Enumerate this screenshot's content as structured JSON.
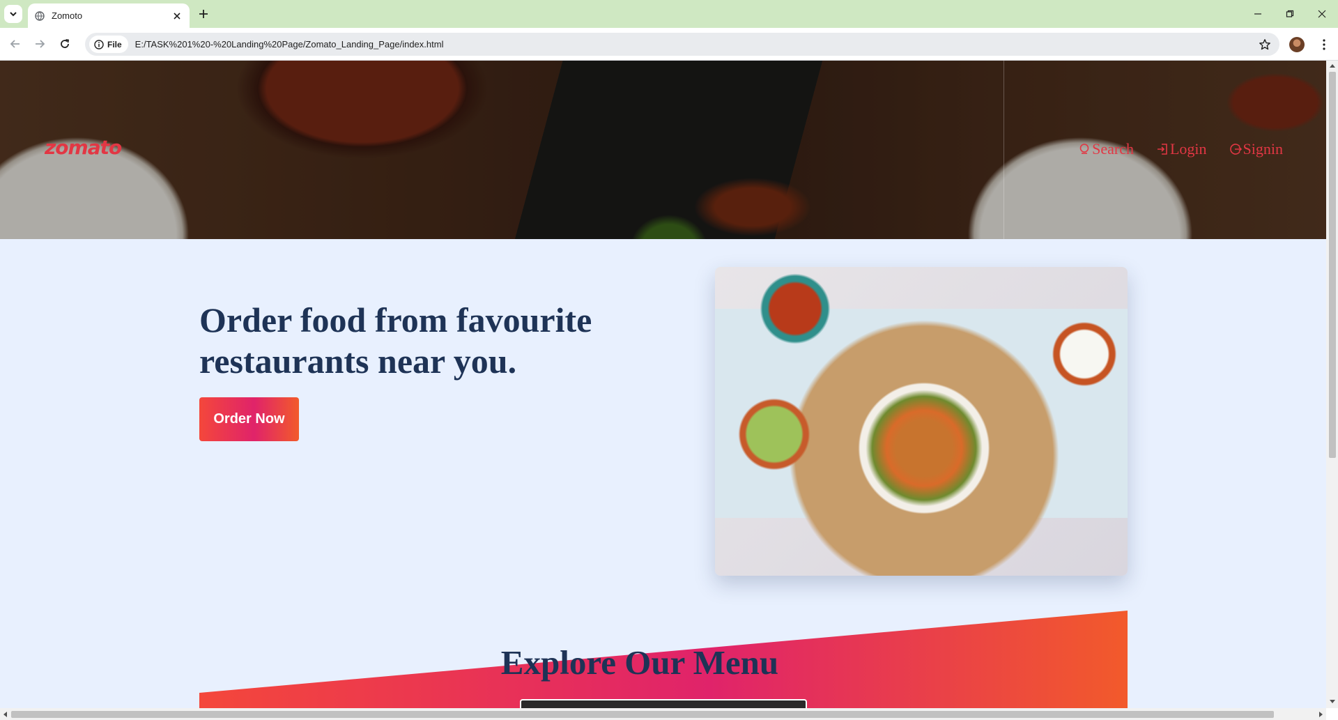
{
  "browser": {
    "tab_title": "Zomoto",
    "tab_favicon": "globe-icon",
    "chip_label": "File",
    "url": "E:/TASK%201%20-%20Landing%20Page/Zomato_Landing_Page/index.html"
  },
  "site": {
    "logo": "zomato",
    "nav": [
      {
        "label": "Search",
        "icon": "search-icon"
      },
      {
        "label": "Login",
        "icon": "login-icon"
      },
      {
        "label": "Signin",
        "icon": "signin-icon"
      }
    ]
  },
  "hero": {
    "heading": "Order food from favourite restaurants near you.",
    "cta_label": "Order Now",
    "image": "food-platter-photo"
  },
  "menu": {
    "title": "Explore Our Menu"
  },
  "colors": {
    "brand_red": "#e23744",
    "heading_navy": "#1e3356",
    "page_bg": "#e8f0fe",
    "gradient_start": "#f4473b",
    "gradient_mid": "#e0236a",
    "gradient_end": "#f25a2b"
  }
}
